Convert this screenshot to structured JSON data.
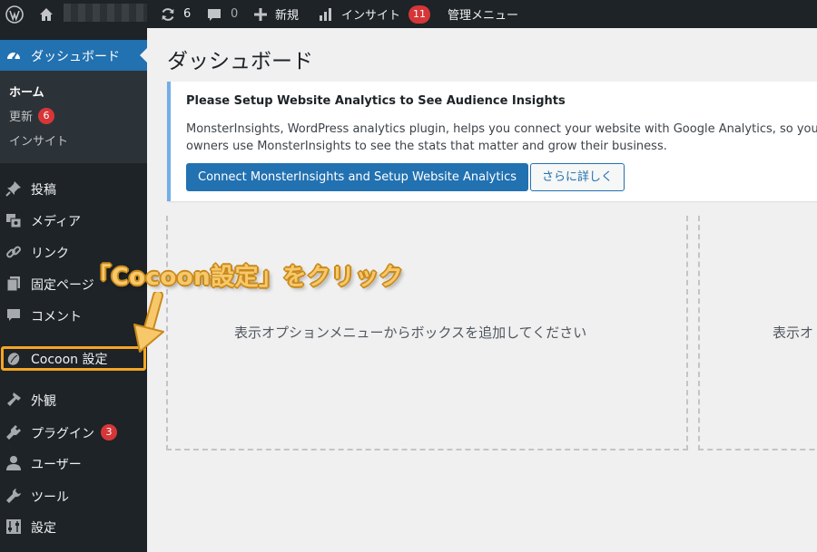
{
  "adminbar": {
    "updates_count": "6",
    "comments_count": "0",
    "new_label": "新規",
    "insights_label": "インサイト",
    "insights_badge": "11",
    "admin_menu_label": "管理メニュー"
  },
  "sidebar": {
    "dashboard_label": "ダッシュボード",
    "submenu": [
      {
        "label": "ホーム"
      },
      {
        "label": "更新",
        "badge": "6"
      },
      {
        "label": "インサイト"
      }
    ],
    "items": [
      {
        "label": "投稿",
        "icon": "pushpin-icon"
      },
      {
        "label": "メディア",
        "icon": "media-icon"
      },
      {
        "label": "リンク",
        "icon": "link-icon"
      },
      {
        "label": "固定ページ",
        "icon": "page-icon"
      },
      {
        "label": "コメント",
        "icon": "comment-icon"
      },
      {
        "label": "Cocoon 設定",
        "icon": "cocoon-icon"
      },
      {
        "label": "外観",
        "icon": "appearance-icon"
      },
      {
        "label": "プラグイン",
        "icon": "plugin-icon",
        "badge": "3"
      },
      {
        "label": "ユーザー",
        "icon": "user-icon"
      },
      {
        "label": "ツール",
        "icon": "tools-icon"
      },
      {
        "label": "設定",
        "icon": "settings-icon"
      }
    ]
  },
  "main": {
    "title": "ダッシュボード",
    "notice": {
      "title": "Please Setup Website Analytics to See Audience Insights",
      "line1": "MonsterInsights, WordPress analytics plugin, helps you connect your website with Google Analytics, so you ca",
      "line2": "owners use MonsterInsights to see the stats that matter and grow their business.",
      "primary_button": "Connect MonsterInsights and Setup Website Analytics",
      "secondary_button": "さらに詳しく"
    },
    "dropzone_text_1": "表示オプションメニューからボックスを追加してください",
    "dropzone_text_2": "表示オ"
  },
  "annotation": {
    "text": "「Cocoon設定」をクリック",
    "color": "#f5a623"
  },
  "colors": {
    "adminbar_bg": "#1d2327",
    "active_menu": "#2271b1",
    "badge": "#d63638",
    "accent": "#2271b1"
  }
}
